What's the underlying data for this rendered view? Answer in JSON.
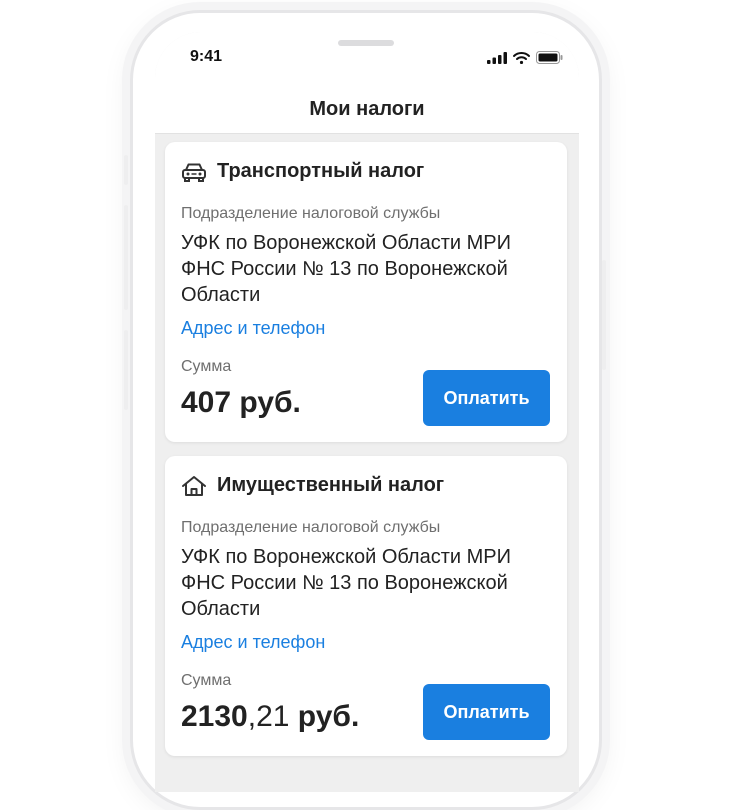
{
  "status_bar": {
    "time": "9:41"
  },
  "nav": {
    "title": "Мои налоги"
  },
  "cards": [
    {
      "title": "Транспортный налог",
      "icon": "car-icon",
      "department_label": "Подразделение налоговой службы",
      "department": "УФК по Воронежской Области МРИ ФНС России № 13 по Воронежской Области",
      "link": "Адрес и телефон",
      "amount_label": "Сумма",
      "amount_main": "407",
      "amount_fraction": "",
      "currency": " руб.",
      "pay_label": "Оплатить"
    },
    {
      "title": "Имущественный налог",
      "icon": "home-icon",
      "department_label": "Подразделение налоговой службы",
      "department": "УФК по Воронежской Области МРИ ФНС России № 13 по Воронежской Области",
      "link": "Адрес и телефон",
      "amount_label": "Сумма",
      "amount_main": "2130",
      "amount_fraction": ",21",
      "currency": " руб.",
      "pay_label": "Оплатить"
    }
  ],
  "colors": {
    "accent": "#1a7fe0",
    "background": "#efefef",
    "card": "#ffffff"
  }
}
